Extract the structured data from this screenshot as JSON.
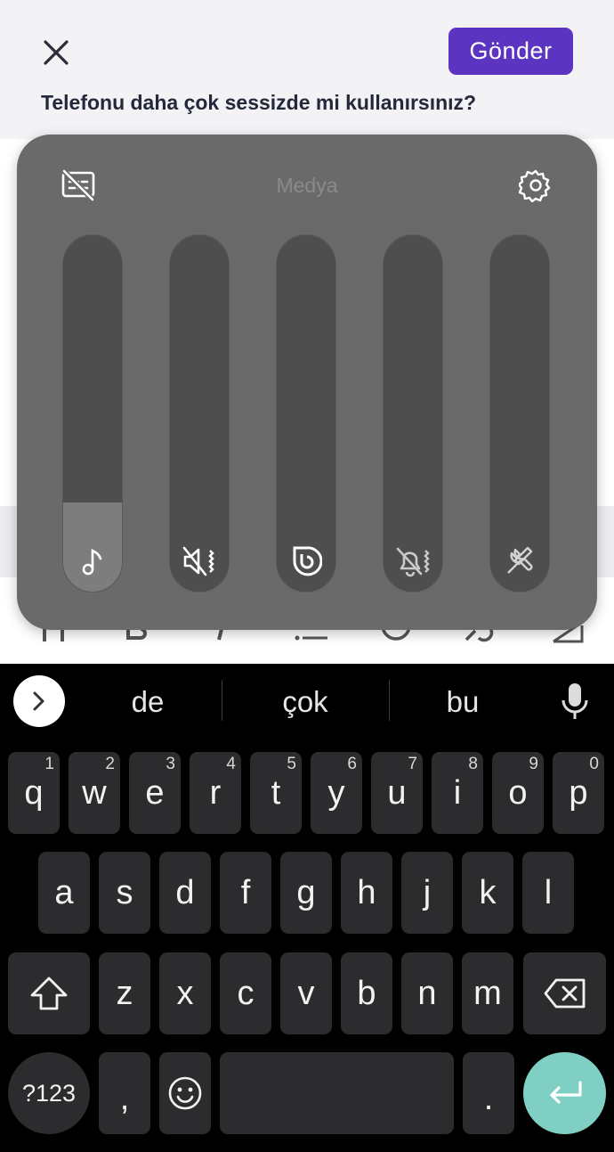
{
  "app": {
    "send_label": "Gönder",
    "question": "Telefonu daha çok sessizde mi kullanırsınız?"
  },
  "volume_panel": {
    "title": "Medya",
    "sliders": [
      {
        "name": "media",
        "icon": "music-note-icon",
        "level": 0.25
      },
      {
        "name": "ringtone",
        "icon": "speaker-mute-vibrate-icon",
        "level": 0.0
      },
      {
        "name": "bixby",
        "icon": "bixby-icon",
        "level": 0.0
      },
      {
        "name": "notifications",
        "icon": "bell-mute-vibrate-icon",
        "level": 0.0
      },
      {
        "name": "system",
        "icon": "tools-icon",
        "level": 0.0
      }
    ]
  },
  "keyboard": {
    "suggestions": [
      "de",
      "çok",
      "bu"
    ],
    "row1": [
      {
        "k": "q",
        "h": "1"
      },
      {
        "k": "w",
        "h": "2"
      },
      {
        "k": "e",
        "h": "3"
      },
      {
        "k": "r",
        "h": "4"
      },
      {
        "k": "t",
        "h": "5"
      },
      {
        "k": "y",
        "h": "6"
      },
      {
        "k": "u",
        "h": "7"
      },
      {
        "k": "i",
        "h": "8"
      },
      {
        "k": "o",
        "h": "9"
      },
      {
        "k": "p",
        "h": "0"
      }
    ],
    "row2": [
      "a",
      "s",
      "d",
      "f",
      "g",
      "h",
      "j",
      "k",
      "l"
    ],
    "row3": [
      "z",
      "x",
      "c",
      "v",
      "b",
      "n",
      "m"
    ],
    "symbols_label": "?123",
    "comma": ",",
    "period": "."
  }
}
